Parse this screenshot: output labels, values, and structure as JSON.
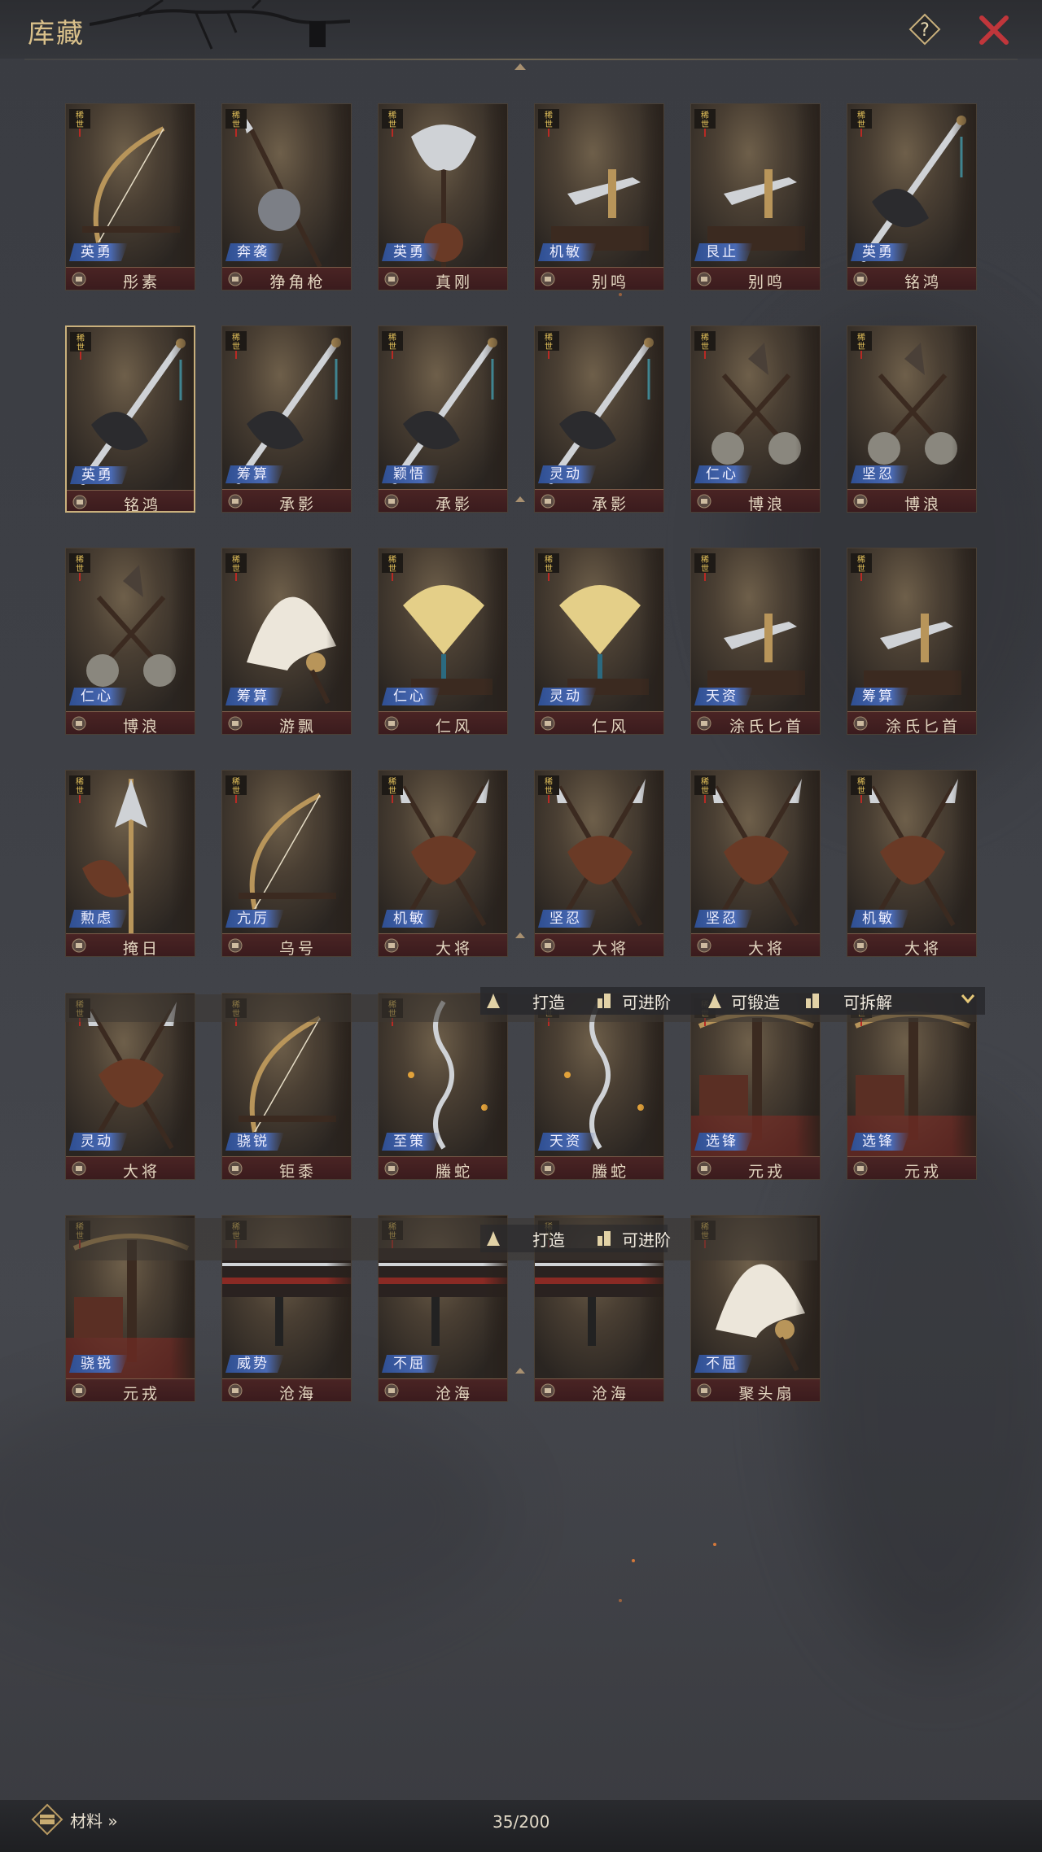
{
  "header": {
    "title": "库藏"
  },
  "rare_badge": "稀世",
  "cards": [
    {
      "trait": "英勇",
      "name": "彤素",
      "weapon": "bow"
    },
    {
      "trait": "奔袭",
      "name": "狰角枪",
      "weapon": "spear"
    },
    {
      "trait": "英勇",
      "name": "真刚",
      "weapon": "axe"
    },
    {
      "trait": "机敏",
      "name": "别鸣",
      "weapon": "dagger"
    },
    {
      "trait": "艮止",
      "name": "别鸣",
      "weapon": "dagger"
    },
    {
      "trait": "英勇",
      "name": "铭鸿",
      "weapon": "sword"
    },
    {
      "trait": "英勇",
      "name": "铭鸿",
      "weapon": "sword",
      "selected": true
    },
    {
      "trait": "筹算",
      "name": "承影",
      "weapon": "sword"
    },
    {
      "trait": "颖悟",
      "name": "承影",
      "weapon": "sword"
    },
    {
      "trait": "灵动",
      "name": "承影",
      "weapon": "sword"
    },
    {
      "trait": "仁心",
      "name": "博浪",
      "weapon": "maces"
    },
    {
      "trait": "坚忍",
      "name": "博浪",
      "weapon": "maces"
    },
    {
      "trait": "仁心",
      "name": "博浪",
      "weapon": "maces"
    },
    {
      "trait": "筹算",
      "name": "游飘",
      "weapon": "featherfan"
    },
    {
      "trait": "仁心",
      "name": "仁风",
      "weapon": "fan"
    },
    {
      "trait": "灵动",
      "name": "仁风",
      "weapon": "fan"
    },
    {
      "trait": "天资",
      "name": "涂氏匕首",
      "weapon": "dagger"
    },
    {
      "trait": "筹算",
      "name": "涂氏匕首",
      "weapon": "dagger"
    },
    {
      "trait": "勲虑",
      "name": "掩日",
      "weapon": "glaive"
    },
    {
      "trait": "亢厉",
      "name": "乌号",
      "weapon": "bow"
    },
    {
      "trait": "机敏",
      "name": "大将",
      "weapon": "crossed"
    },
    {
      "trait": "坚忍",
      "name": "大将",
      "weapon": "crossed"
    },
    {
      "trait": "坚忍",
      "name": "大将",
      "weapon": "crossed"
    },
    {
      "trait": "机敏",
      "name": "大将",
      "weapon": "crossed"
    },
    {
      "trait": "灵动",
      "name": "大将",
      "weapon": "crossed"
    },
    {
      "trait": "骁锐",
      "name": "钜黍",
      "weapon": "bow"
    },
    {
      "trait": "至策",
      "name": "螣蛇",
      "weapon": "serpent"
    },
    {
      "trait": "天资",
      "name": "螣蛇",
      "weapon": "serpent"
    },
    {
      "trait": "选锋",
      "name": "元戎",
      "weapon": "crossbow"
    },
    {
      "trait": "选锋",
      "name": "元戎",
      "weapon": "crossbow"
    },
    {
      "trait": "骁锐",
      "name": "元戎",
      "weapon": "crossbow"
    },
    {
      "trait": "威势",
      "name": "沧海",
      "weapon": "rack"
    },
    {
      "trait": "不屈",
      "name": "沧海",
      "weapon": "rack"
    },
    {
      "trait": "",
      "name": "沧海",
      "weapon": "rack"
    },
    {
      "trait": "不屈",
      "name": "聚头扇",
      "weapon": "featherfan"
    }
  ],
  "filters": {
    "forge": "可锻造",
    "forge_cut": "打造",
    "advance_cut": "可进阶",
    "dismantle": "可拆解"
  },
  "footer": {
    "materials_label": "材料 »",
    "count": "35/200"
  },
  "colors": {
    "gold": "#d9c08a",
    "close_red": "#c0363b",
    "trait_blue": "#3a5aa6",
    "name_bar": "#3f1f21"
  }
}
